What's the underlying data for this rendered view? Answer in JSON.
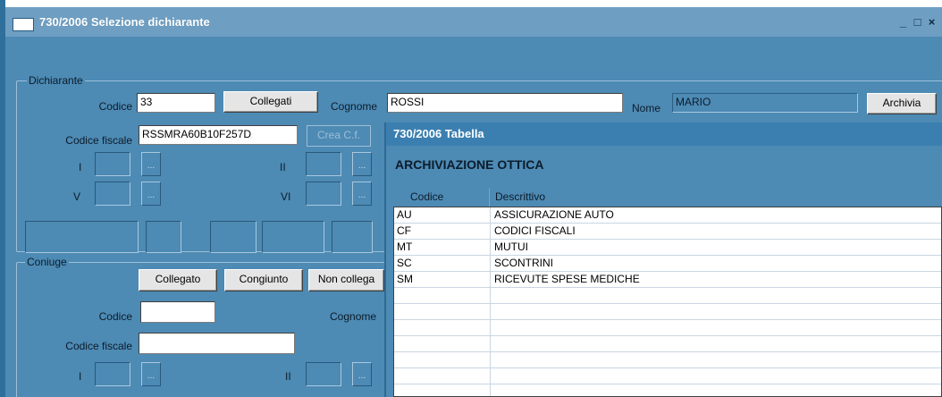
{
  "window": {
    "title": "730/2006 Selezione dichiarante",
    "controls": {
      "minimize": "_",
      "maximize": "□",
      "close": "×"
    }
  },
  "dichiarante": {
    "group_label": "Dichiarante",
    "codice_label": "Codice",
    "codice_value": "33",
    "collegati_button": "Collegati",
    "cognome_label": "Cognome",
    "cognome_value": "ROSSI",
    "nome_label": "Nome",
    "nome_value": "MARIO",
    "archivia_button": "Archivia",
    "codice_fiscale_label": "Codice fiscale",
    "codice_fiscale_value": "RSSMRA60B10F257D",
    "crea_cf_button": "Crea C.f.",
    "field_I": "I",
    "field_II": "II",
    "field_V": "V",
    "field_VI": "VI",
    "ellipsis": "..."
  },
  "coniuge": {
    "group_label": "Coniuge",
    "collegato_button": "Collegato",
    "congiunto_button": "Congiunto",
    "non_collegato_button": "Non collega",
    "codice_label": "Codice",
    "codice_value": "",
    "cognome_label": "Cognome",
    "codice_fiscale_label": "Codice fiscale",
    "codice_fiscale_value": "",
    "field_I": "I",
    "field_II": "II",
    "ellipsis": "..."
  },
  "tabella": {
    "title": "730/2006 Tabella",
    "heading": "ARCHIVIAZIONE OTTICA",
    "columns": [
      "Codice",
      "Descrittivo"
    ],
    "rows": [
      {
        "codice": "AU",
        "descrittivo": "ASSICURAZIONE AUTO"
      },
      {
        "codice": "CF",
        "descrittivo": "CODICI FISCALI"
      },
      {
        "codice": "MT",
        "descrittivo": "MUTUI"
      },
      {
        "codice": "SC",
        "descrittivo": "SCONTRINI"
      },
      {
        "codice": "SM",
        "descrittivo": "RICEVUTE SPESE MEDICHE"
      }
    ],
    "empty_rows": 6
  },
  "colors": {
    "background": "#4d8ab4",
    "titlebar": "#6e9fc3",
    "table_title": "#3b7fb0"
  }
}
